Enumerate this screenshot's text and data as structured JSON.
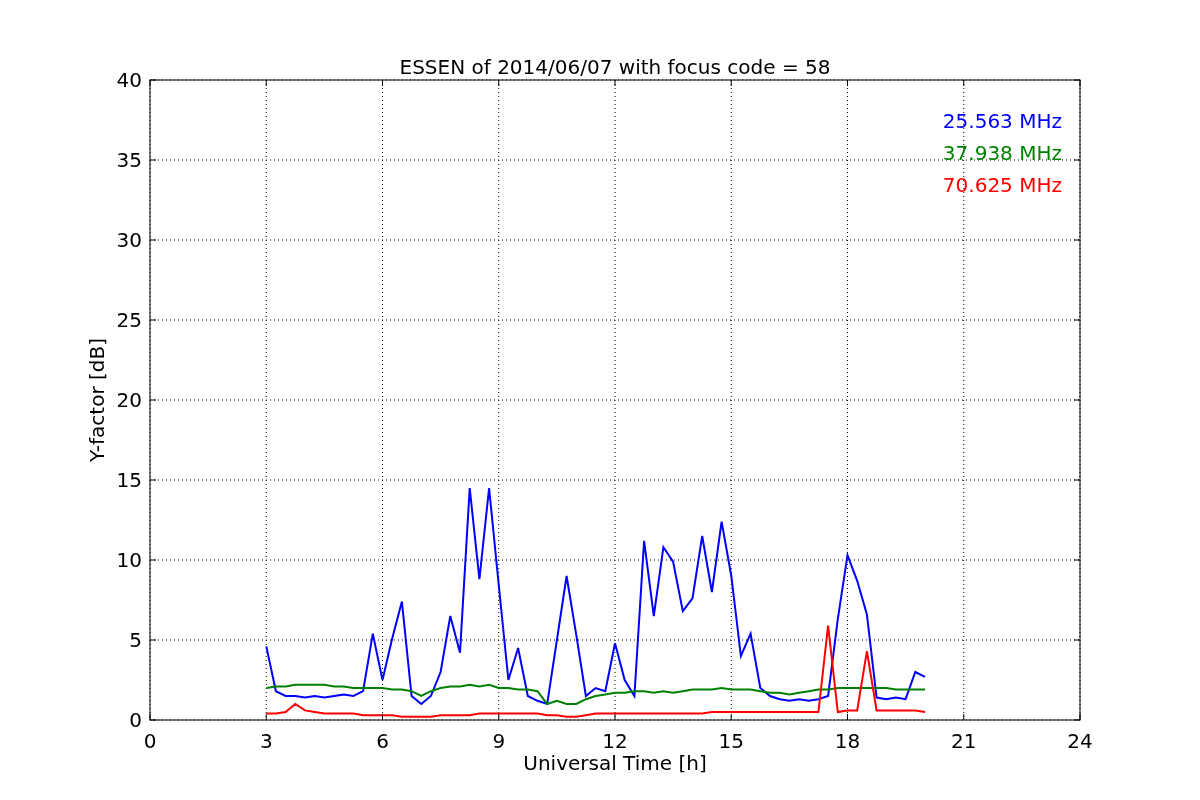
{
  "chart_data": {
    "type": "line",
    "title": "ESSEN of 2014/06/07 with focus code = 58",
    "xlabel": "Universal Time [h]",
    "ylabel": "Y-factor [dB]",
    "x": [
      3,
      3.25,
      3.5,
      3.75,
      4,
      4.25,
      4.5,
      4.75,
      5,
      5.25,
      5.5,
      5.75,
      6,
      6.25,
      6.5,
      6.75,
      7,
      7.25,
      7.5,
      7.75,
      8,
      8.25,
      8.5,
      8.75,
      9,
      9.25,
      9.5,
      9.75,
      10,
      10.25,
      10.5,
      10.75,
      11,
      11.25,
      11.5,
      11.75,
      12,
      12.25,
      12.5,
      12.75,
      13,
      13.25,
      13.5,
      13.75,
      14,
      14.25,
      14.5,
      14.75,
      15,
      15.25,
      15.5,
      15.75,
      16,
      16.25,
      16.5,
      16.75,
      17,
      17.25,
      17.5,
      17.75,
      18,
      18.25,
      18.5,
      18.75,
      19,
      19.25,
      19.5,
      19.75,
      20
    ],
    "series": [
      {
        "name": "25.563 MHz",
        "color": "#0000ff",
        "values": [
          4.6,
          1.8,
          1.5,
          1.5,
          1.4,
          1.5,
          1.4,
          1.5,
          1.6,
          1.5,
          1.8,
          5.4,
          2.5,
          5.1,
          7.4,
          1.5,
          1.0,
          1.5,
          3.0,
          6.5,
          4.2,
          14.5,
          8.8,
          14.5,
          8.4,
          2.5,
          4.5,
          1.5,
          1.2,
          1.0,
          5.0,
          9.0,
          5.3,
          1.5,
          2.0,
          1.8,
          4.8,
          2.5,
          1.5,
          11.2,
          6.5,
          10.8,
          9.9,
          6.8,
          7.6,
          11.5,
          8.0,
          12.4,
          9.0,
          4.0,
          5.4,
          2.0,
          1.5,
          1.3,
          1.2,
          1.3,
          1.2,
          1.3,
          1.5,
          6.3,
          10.3,
          8.7,
          6.6,
          1.4,
          1.3,
          1.4,
          1.3,
          3.0,
          2.7
        ]
      },
      {
        "name": "37.938 MHz",
        "color": "#008000",
        "values": [
          2.0,
          2.1,
          2.1,
          2.2,
          2.2,
          2.2,
          2.2,
          2.1,
          2.1,
          2.0,
          2.0,
          2.0,
          2.0,
          1.9,
          1.9,
          1.8,
          1.5,
          1.8,
          2.0,
          2.1,
          2.1,
          2.2,
          2.1,
          2.2,
          2.0,
          2.0,
          1.9,
          1.9,
          1.8,
          1.0,
          1.2,
          1.0,
          1.0,
          1.3,
          1.5,
          1.6,
          1.7,
          1.7,
          1.8,
          1.8,
          1.7,
          1.8,
          1.7,
          1.8,
          1.9,
          1.9,
          1.9,
          2.0,
          1.9,
          1.9,
          1.9,
          1.8,
          1.7,
          1.7,
          1.6,
          1.7,
          1.8,
          1.9,
          1.9,
          2.0,
          2.0,
          2.0,
          2.0,
          2.0,
          2.0,
          1.9,
          1.9,
          1.9,
          1.9
        ]
      },
      {
        "name": "70.625 MHz",
        "color": "#ff0000",
        "values": [
          0.4,
          0.4,
          0.5,
          1.0,
          0.6,
          0.5,
          0.4,
          0.4,
          0.4,
          0.4,
          0.3,
          0.3,
          0.3,
          0.3,
          0.2,
          0.2,
          0.2,
          0.2,
          0.3,
          0.3,
          0.3,
          0.3,
          0.4,
          0.4,
          0.4,
          0.4,
          0.4,
          0.4,
          0.4,
          0.3,
          0.3,
          0.2,
          0.2,
          0.3,
          0.4,
          0.4,
          0.4,
          0.4,
          0.4,
          0.4,
          0.4,
          0.4,
          0.4,
          0.4,
          0.4,
          0.4,
          0.5,
          0.5,
          0.5,
          0.5,
          0.5,
          0.5,
          0.5,
          0.5,
          0.5,
          0.5,
          0.5,
          0.5,
          5.9,
          0.5,
          0.6,
          0.6,
          4.3,
          0.6,
          0.6,
          0.6,
          0.6,
          0.6,
          0.5
        ]
      }
    ],
    "grid": true,
    "xlim": [
      0,
      24
    ],
    "ylim": [
      0,
      40
    ],
    "xticks": [
      0,
      3,
      6,
      9,
      12,
      15,
      18,
      21,
      24
    ],
    "yticks": [
      0,
      5,
      10,
      15,
      20,
      25,
      30,
      35,
      40
    ]
  }
}
